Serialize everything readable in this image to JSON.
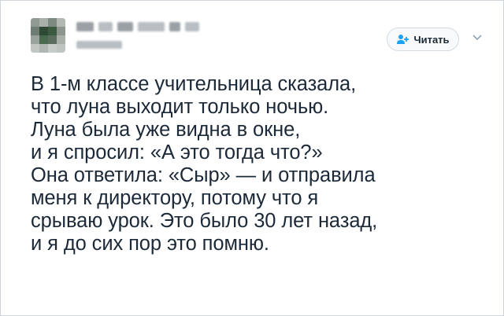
{
  "follow_button": {
    "label": "Читать",
    "icon": "follow-person-plus-icon",
    "accent": "#1da1f2"
  },
  "menu": {
    "icon": "chevron-down-icon"
  },
  "tweet": {
    "lines": [
      "В 1-м классе учительница сказала,",
      "что луна выходит только ночью.",
      "Луна была уже видна в окне,",
      "и я спросил: «А это тогда что?»",
      "Она ответила: «Сыр» — и отправила",
      "меня к директору, потому что я",
      "срываю урок. Это было 30 лет назад,",
      "и я до сих пор это помню."
    ]
  },
  "colors": {
    "text": "#1c2938",
    "border": "#cfd5db"
  }
}
